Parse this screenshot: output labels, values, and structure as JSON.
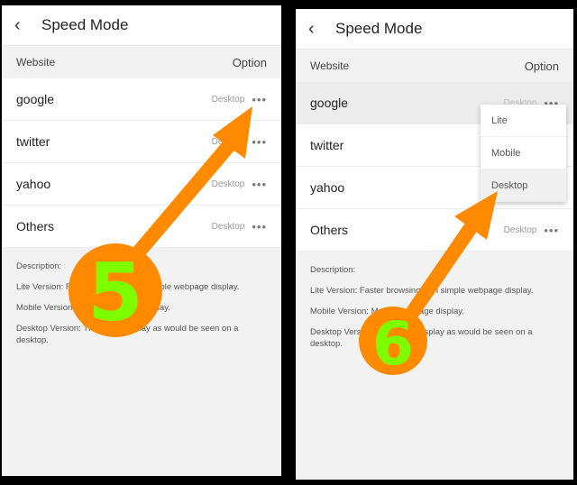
{
  "left": {
    "title": "Speed Mode",
    "col_website": "Website",
    "col_option": "Option",
    "rows": [
      {
        "site": "google",
        "mode": "Desktop"
      },
      {
        "site": "twitter",
        "mode": "Desktop"
      },
      {
        "site": "yahoo",
        "mode": "Desktop"
      },
      {
        "site": "Others",
        "mode": "Desktop"
      }
    ],
    "description": {
      "heading": "Description:",
      "lite": "Lite Version: Faster browsing with simple webpage display.",
      "mobile": "Mobile Version: Mobile webpage display.",
      "desktop": "Desktop Version: The same display as would be seen on a desktop."
    }
  },
  "right": {
    "title": "Speed Mode",
    "col_website": "Website",
    "col_option": "Option",
    "rows": [
      {
        "site": "google",
        "mode": "Desktop"
      },
      {
        "site": "twitter",
        "mode": ""
      },
      {
        "site": "yahoo",
        "mode": ""
      },
      {
        "site": "Others",
        "mode": "Desktop"
      }
    ],
    "dropdown": [
      "Lite",
      "Mobile",
      "Desktop"
    ],
    "description": {
      "heading": "Description:",
      "lite": "Lite Version: Faster browsing with simple webpage display.",
      "mobile": "Mobile Version: Mobile webpage display.",
      "desktop": "Desktop Version: The same display as would be seen on a desktop."
    }
  },
  "annotations": {
    "step_left": "5",
    "step_right": "6",
    "arrow_color": "#ff8a00",
    "number_color": "#7dff00"
  },
  "icons": {
    "back": "chevron-left-icon",
    "more": "more-dots-icon"
  }
}
